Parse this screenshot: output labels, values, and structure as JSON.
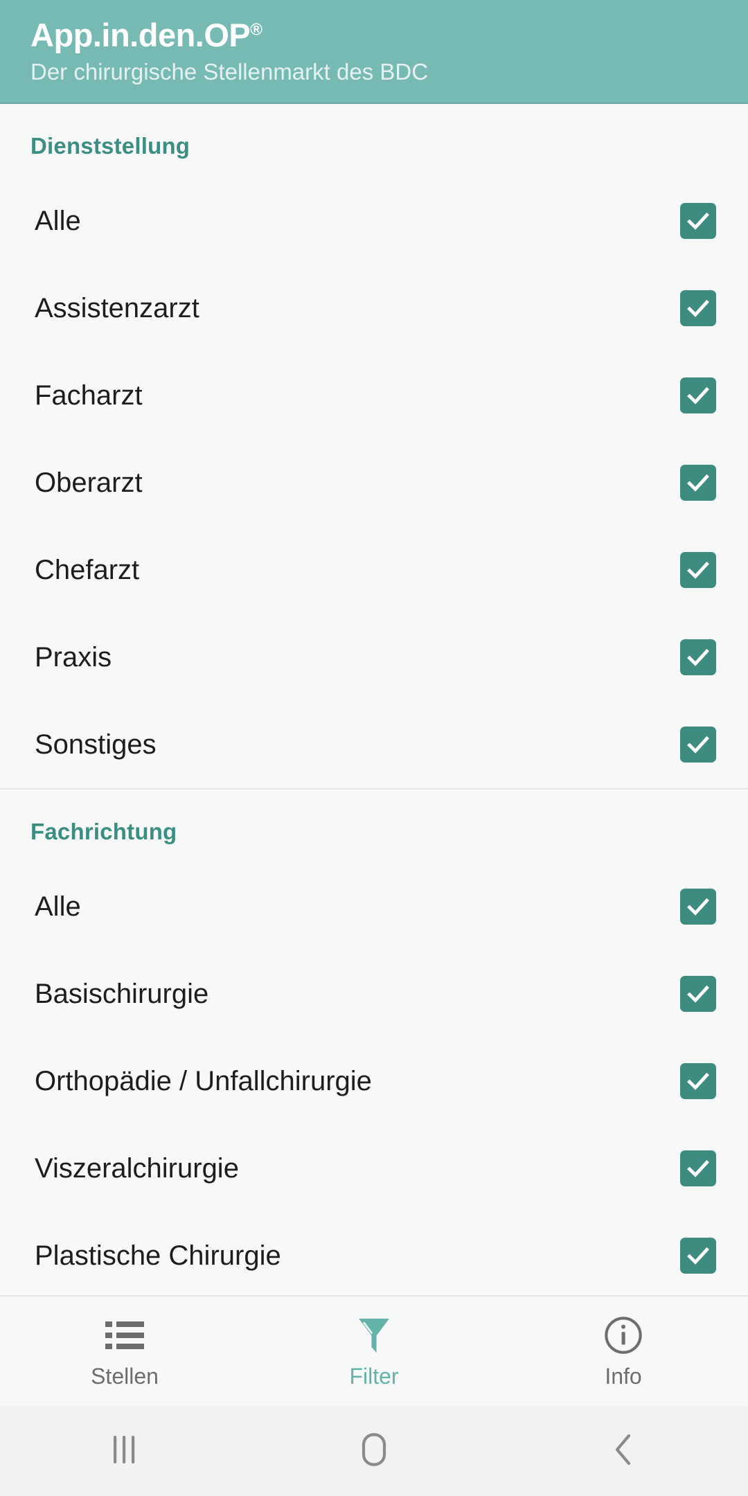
{
  "header": {
    "title": "App.in.den.OP",
    "title_superscript": "®",
    "subtitle": "Der chirurgische Stellenmarkt des BDC",
    "background_color": "#76bab3",
    "title_color": "#ffffff",
    "subtitle_color": "#e4f1ef"
  },
  "accent_colors": {
    "section_title": "#3c8d82",
    "checkbox_fill": "#3e8c80",
    "active_tab": "#64b3a8",
    "inactive_tab": "#6d6d6d",
    "page_background": "#f7f8f8"
  },
  "sections": [
    {
      "title": "Dienststellung",
      "options": [
        {
          "label": "Alle",
          "checked": true
        },
        {
          "label": "Assistenzarzt",
          "checked": true
        },
        {
          "label": "Facharzt",
          "checked": true
        },
        {
          "label": "Oberarzt",
          "checked": true
        },
        {
          "label": "Chefarzt",
          "checked": true
        },
        {
          "label": "Praxis",
          "checked": true
        },
        {
          "label": "Sonstiges",
          "checked": true
        }
      ]
    },
    {
      "title": "Fachrichtung",
      "options": [
        {
          "label": "Alle",
          "checked": true
        },
        {
          "label": "Basischirurgie",
          "checked": true
        },
        {
          "label": "Orthopädie / Unfallchirurgie",
          "checked": true
        },
        {
          "label": "Viszeralchirurgie",
          "checked": true
        },
        {
          "label": "Plastische Chirurgie",
          "checked": true
        }
      ]
    }
  ],
  "bottom_nav": {
    "tabs": [
      {
        "label": "Stellen",
        "icon": "list-icon",
        "active": false
      },
      {
        "label": "Filter",
        "icon": "funnel-icon",
        "active": true
      },
      {
        "label": "Info",
        "icon": "info-icon",
        "active": false
      }
    ]
  },
  "system_nav": {
    "buttons": [
      {
        "name": "recents-icon",
        "glyph": "|||"
      },
      {
        "name": "home-icon",
        "glyph": "◻"
      },
      {
        "name": "back-icon",
        "glyph": "‹"
      }
    ]
  }
}
